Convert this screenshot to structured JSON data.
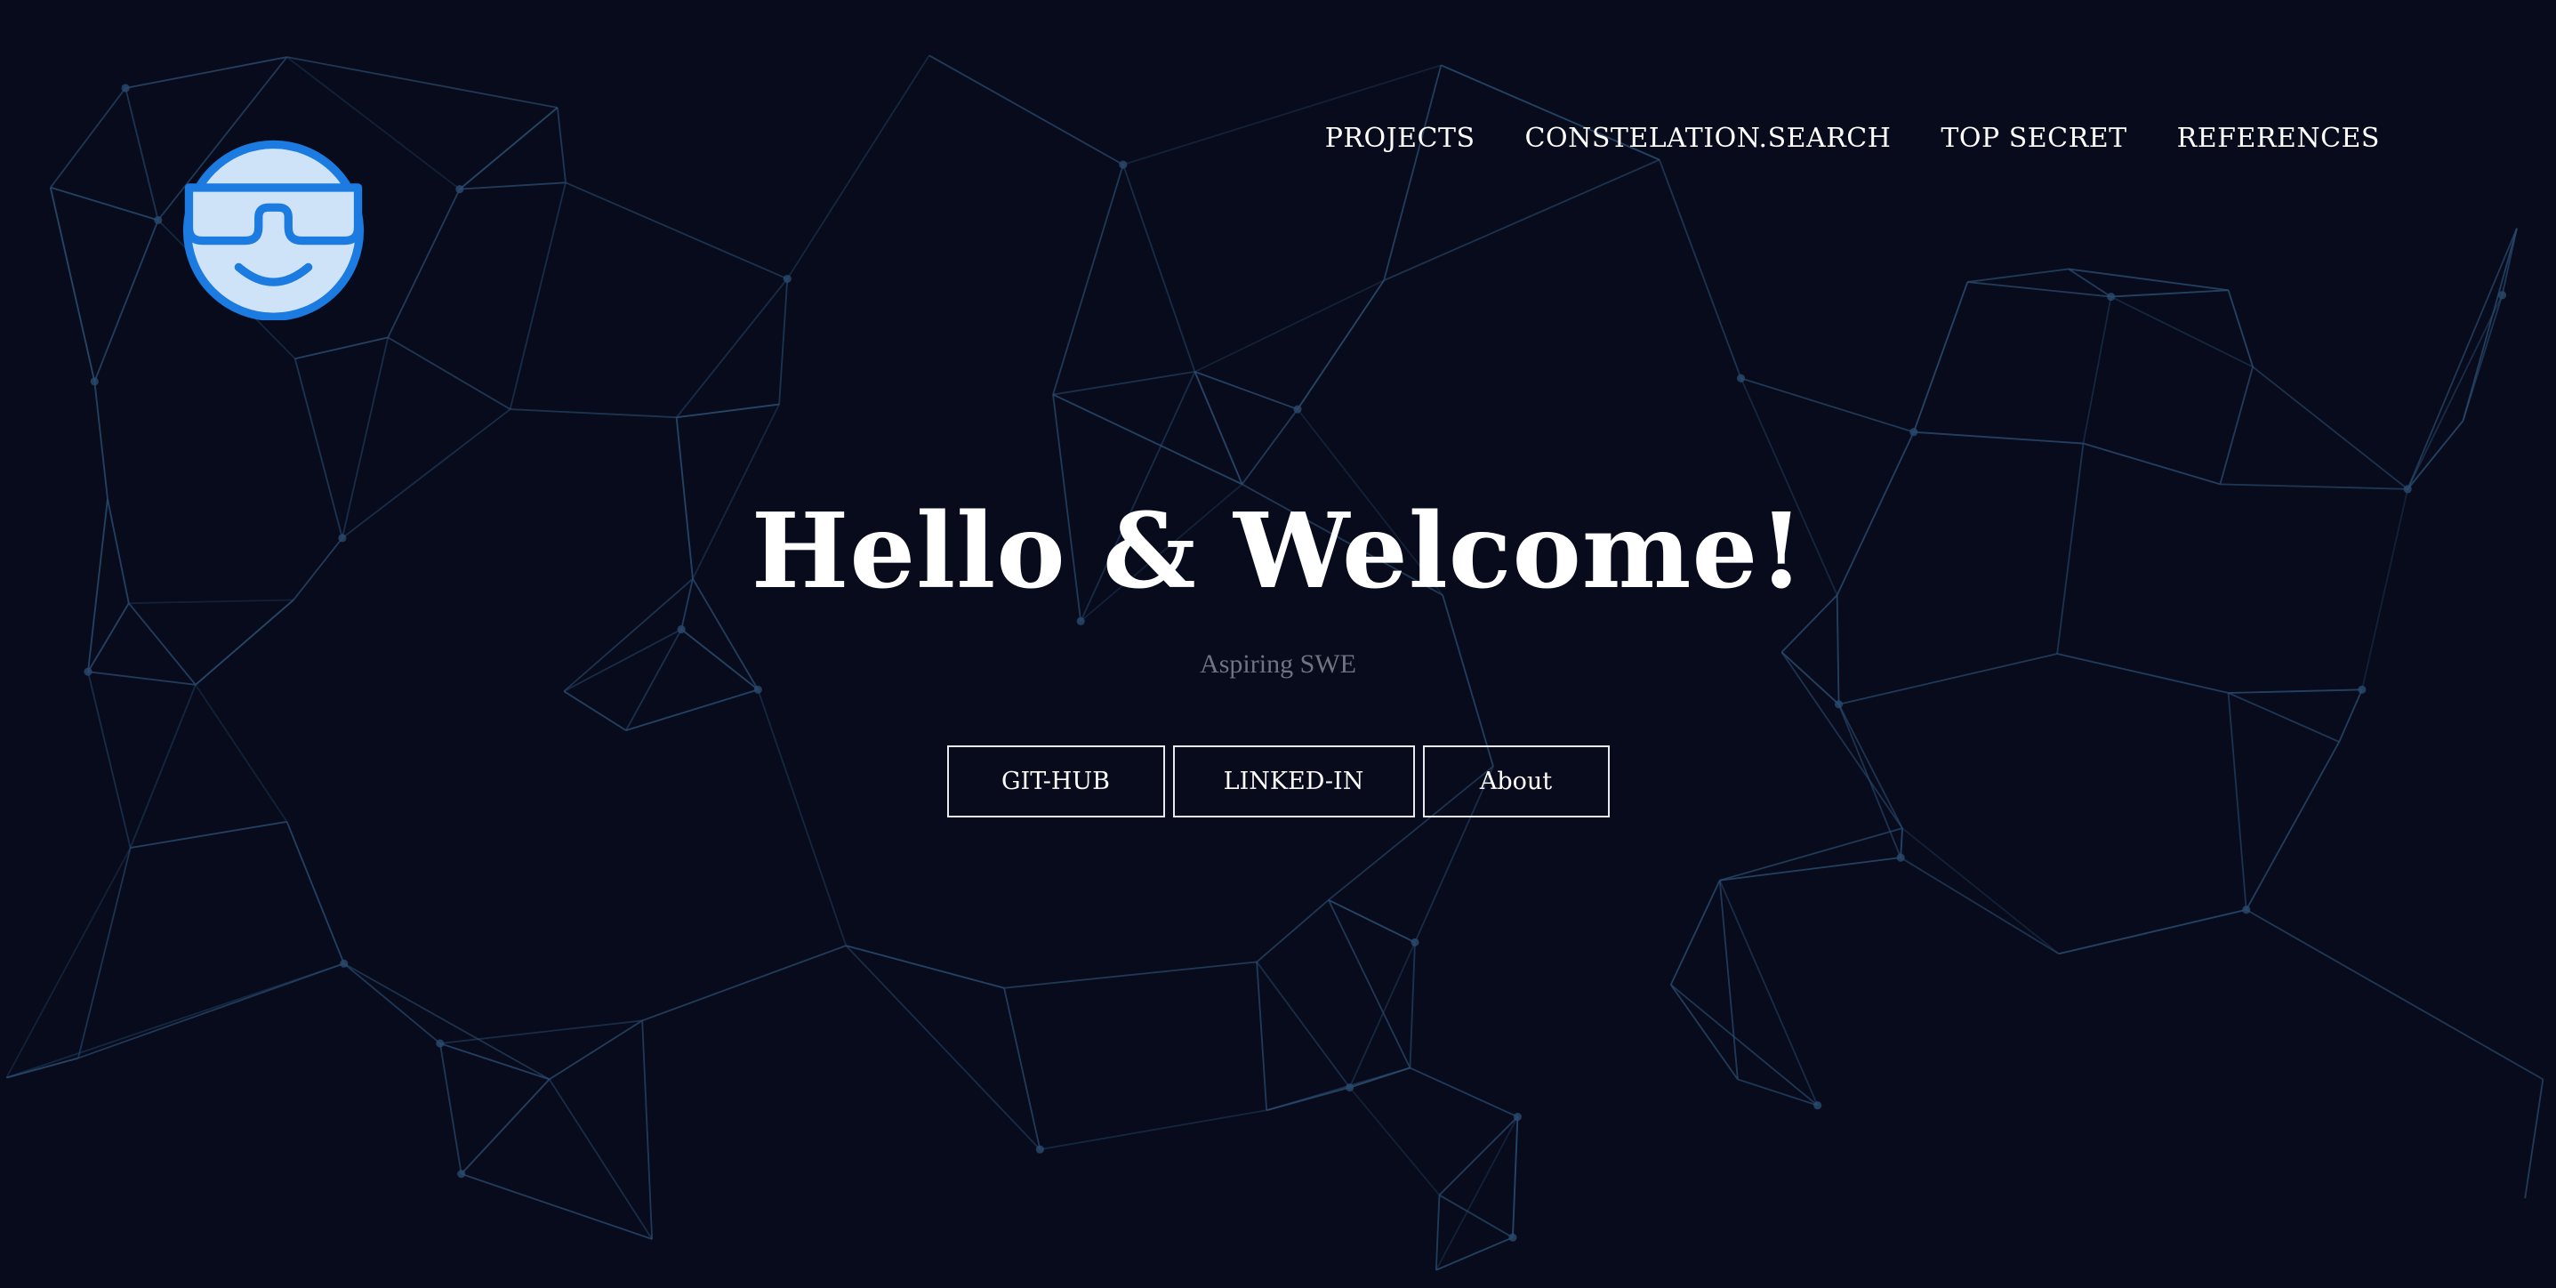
{
  "logo": {
    "icon": "sunglasses-face-icon",
    "accent": "#1b7be0",
    "fill": "#cfe3f8"
  },
  "nav": {
    "items": [
      {
        "label": "PROJECTS"
      },
      {
        "label": "CONSTELATION.SEARCH"
      },
      {
        "label": "TOP SECRET"
      },
      {
        "label": "REFERENCES"
      }
    ]
  },
  "hero": {
    "title": "Hello & Welcome!",
    "subtitle": "Aspiring SWE",
    "buttons": {
      "github": "GIT-HUB",
      "linkedin": "LINKED-IN",
      "about": "About"
    }
  },
  "theme": {
    "background": "#070b1c",
    "network_line": "#2a4a6e",
    "button_border": "#e8eaf0",
    "subtitle_color": "#6f7480"
  }
}
